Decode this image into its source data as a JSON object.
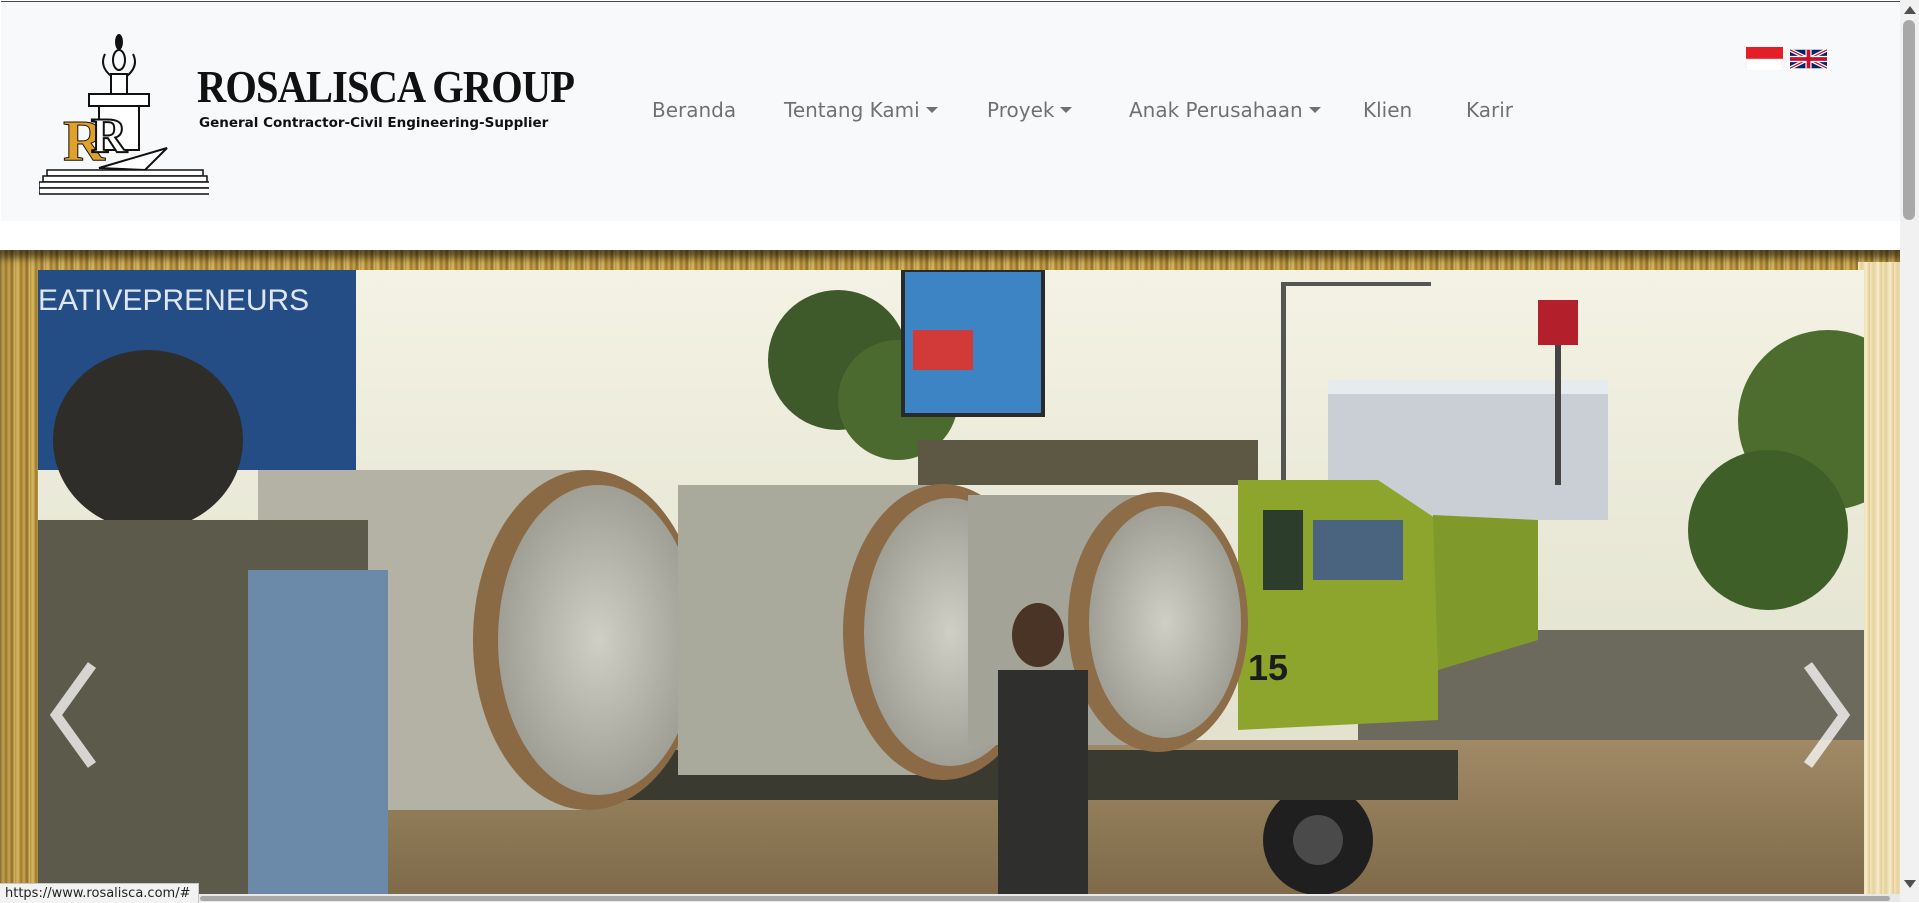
{
  "brand": {
    "title": "ROSALISCA GROUP",
    "subtitle": "General Contractor-Civil Engineering-Supplier"
  },
  "nav": {
    "items": [
      {
        "label": "Beranda",
        "dropdown": false
      },
      {
        "label": "Tentang Kami",
        "dropdown": true
      },
      {
        "label": "Proyek",
        "dropdown": true
      },
      {
        "label": "Anak Perusahaan",
        "dropdown": true
      },
      {
        "label": "Klien",
        "dropdown": false
      },
      {
        "label": "Karir",
        "dropdown": false
      }
    ]
  },
  "languages": [
    {
      "icon": "flag-indonesia-icon"
    },
    {
      "icon": "flag-uk-icon"
    }
  ],
  "carousel": {
    "billboard_text": "EATIVEPRENEURS",
    "truck_number": "15",
    "prev_icon": "chevron-left-icon",
    "next_icon": "chevron-right-icon"
  },
  "status_bar": {
    "url": "https://www.rosalisca.com/#"
  },
  "colors": {
    "navbar_bg": "#f8f9fa",
    "nav_text": "#6c757d",
    "logo_gold": "#e0a12a",
    "frame_gold": "#c8a654"
  }
}
